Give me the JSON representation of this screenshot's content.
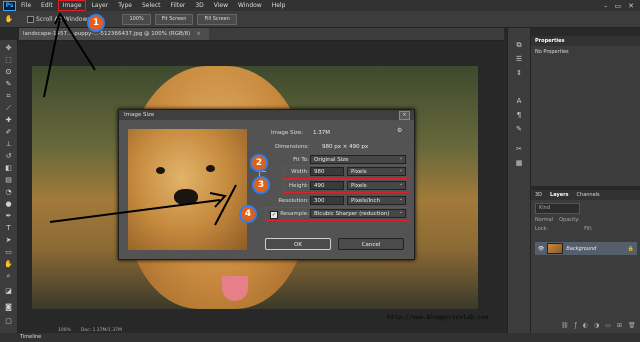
{
  "app": {
    "logo": "Ps"
  },
  "menubar": {
    "items": [
      "File",
      "Edit",
      "Image",
      "Layer",
      "Type",
      "Select",
      "Filter",
      "3D",
      "View",
      "Window",
      "Help"
    ],
    "highlighted": "Image",
    "window_controls": [
      "–",
      "▭",
      "✕"
    ]
  },
  "options_bar": {
    "scroll_all_windows": "Scroll All Windows",
    "btn_100": "100%",
    "btn_fit": "Fit Screen",
    "btn_fill": "Fill Screen"
  },
  "document_tab": {
    "label": "landscape-1457...-puppy-...-512366437.jpg @ 100% (RGB/8)",
    "close": "×"
  },
  "status": {
    "zoom": "100%",
    "doc": "Doc: 1.37M/1.37M"
  },
  "timeline": {
    "label": "Timeline"
  },
  "watermark": "http://www.bloggerscolab.com",
  "panels": {
    "properties": {
      "tab": "Properties",
      "body": "No Properties"
    },
    "layers": {
      "tabs": [
        "3D",
        "Layers",
        "Channels"
      ],
      "active_tab": "Layers",
      "kind": "Kind",
      "blend": "Normal",
      "opacity": "Opacity:",
      "lock": "Lock:",
      "fill": "Fill:",
      "layer_name": "Background"
    }
  },
  "dialog": {
    "title": "Image Size",
    "close": "×",
    "image_size_label": "Image Size:",
    "image_size_value": "1.37M",
    "dimensions_label": "Dimensions:",
    "dimensions_value": "980 px  ×  490 px",
    "fit_to_label": "Fit To:",
    "fit_to_value": "Original Size",
    "width_label": "Width:",
    "width_value": "980",
    "width_unit": "Pixels",
    "height_label": "Height:",
    "height_value": "490",
    "height_unit": "Pixels",
    "resolution_label": "Resolution:",
    "resolution_value": "300",
    "resolution_unit": "Pixels/Inch",
    "resample_label": "Resample:",
    "resample_value": "Bicubic Sharper (reduction)",
    "resample_checked": true,
    "ok": "OK",
    "cancel": "Cancel"
  },
  "annotations": {
    "steps": [
      "1",
      "2",
      "3",
      "4"
    ],
    "highlight_color": "#e01e2a",
    "step_ring_color": "#2f7ff0"
  }
}
